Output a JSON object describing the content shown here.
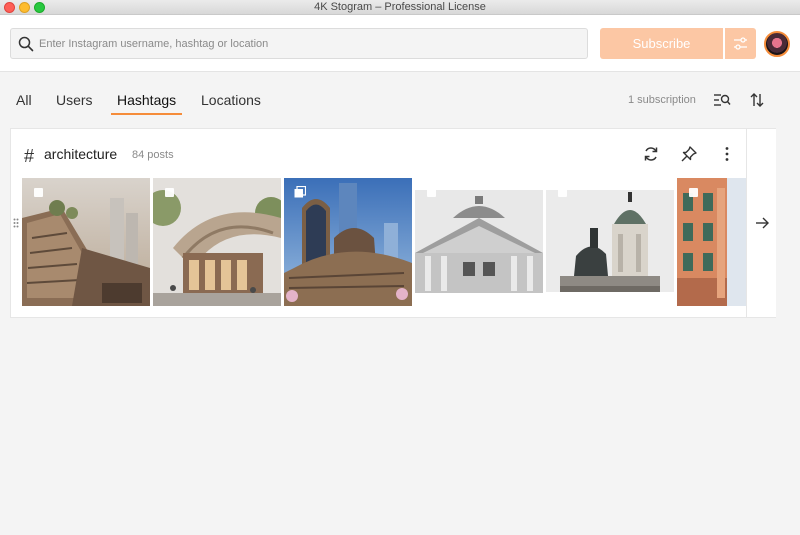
{
  "window": {
    "title": "4K Stogram – Professional License"
  },
  "search": {
    "placeholder": "Enter Instagram username, hashtag or location",
    "value": ""
  },
  "toolbar": {
    "subscribe_label": "Subscribe"
  },
  "tabs": [
    {
      "label": "All",
      "active": false
    },
    {
      "label": "Users",
      "active": false
    },
    {
      "label": "Hashtags",
      "active": true
    },
    {
      "label": "Locations",
      "active": false
    }
  ],
  "subscriptions": {
    "count_label": "1 subscription"
  },
  "card": {
    "icon": "hash-icon",
    "title": "architecture",
    "posts_label": "84 posts"
  },
  "colors": {
    "accent": "#f58c3a",
    "subscribe_bg": "#fcc7a4",
    "background": "#f4f4f4"
  },
  "icons": [
    "search-icon",
    "filter-sliders-icon",
    "avatar",
    "list-search-icon",
    "sort-icon",
    "refresh-icon",
    "pin-icon",
    "more-vertical-icon",
    "arrow-right-icon",
    "drag-handle-icon",
    "checkbox-icon",
    "multiple-images-icon"
  ]
}
